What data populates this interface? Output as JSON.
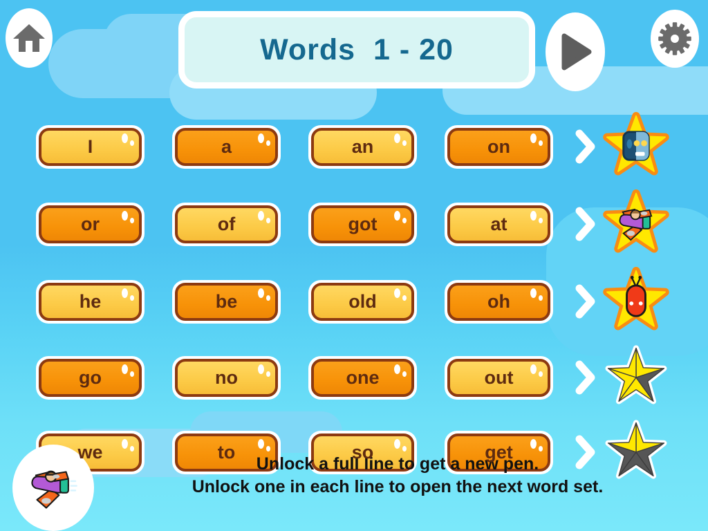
{
  "app": {
    "background_top_color": "#4cc3f2",
    "background_bottom_color": "#7ae8fa"
  },
  "header": {
    "home_icon": "home-icon",
    "settings_icon": "gear-icon",
    "play_icon": "play-icon",
    "title": "Words  1 - 20"
  },
  "palette": {
    "word_light": "#fcca46",
    "word_dark": "#f79208",
    "word_border": "#8c3a11",
    "word_text": "#5e2b10",
    "title_text": "#15688f",
    "title_panel": "#d8f5f4",
    "star_gold": "#ffe800",
    "star_gray": "#565656",
    "star_glow": "#f98c12"
  },
  "word_grid": {
    "rows": [
      {
        "words": [
          {
            "label": "I",
            "state": "light"
          },
          {
            "label": "a",
            "state": "dark"
          },
          {
            "label": "an",
            "state": "light"
          },
          {
            "label": "on",
            "state": "dark"
          }
        ],
        "chevron": "chevron-right-icon",
        "reward": {
          "type": "character-star",
          "character": "robot-head",
          "filled_wedges": 5
        }
      },
      {
        "words": [
          {
            "label": "or",
            "state": "dark"
          },
          {
            "label": "of",
            "state": "light"
          },
          {
            "label": "got",
            "state": "dark"
          },
          {
            "label": "at",
            "state": "light"
          }
        ],
        "chevron": "chevron-right-icon",
        "reward": {
          "type": "character-star",
          "character": "airplane",
          "filled_wedges": 5
        }
      },
      {
        "words": [
          {
            "label": "he",
            "state": "light"
          },
          {
            "label": "be",
            "state": "dark"
          },
          {
            "label": "old",
            "state": "light"
          },
          {
            "label": "oh",
            "state": "dark"
          }
        ],
        "chevron": "chevron-right-icon",
        "reward": {
          "type": "character-star",
          "character": "red-bug",
          "filled_wedges": 5
        }
      },
      {
        "words": [
          {
            "label": "go",
            "state": "dark"
          },
          {
            "label": "no",
            "state": "light"
          },
          {
            "label": "one",
            "state": "dark"
          },
          {
            "label": "out",
            "state": "light"
          }
        ],
        "chevron": "chevron-right-icon",
        "reward": {
          "type": "progress-star",
          "character": null,
          "filled_wedges": 4
        }
      },
      {
        "words": [
          {
            "label": "we",
            "state": "light"
          },
          {
            "label": "to",
            "state": "dark"
          },
          {
            "label": "so",
            "state": "light"
          },
          {
            "label": "get",
            "state": "dark"
          }
        ],
        "chevron": "chevron-right-icon",
        "reward": {
          "type": "progress-star",
          "character": null,
          "filled_wedges": 2
        }
      }
    ]
  },
  "footer": {
    "badge_icon": "airplane-icon",
    "hint_line_1": "Unlock a full line to get a new pen.",
    "hint_line_2": "Unlock one in each line to open the next word set."
  }
}
